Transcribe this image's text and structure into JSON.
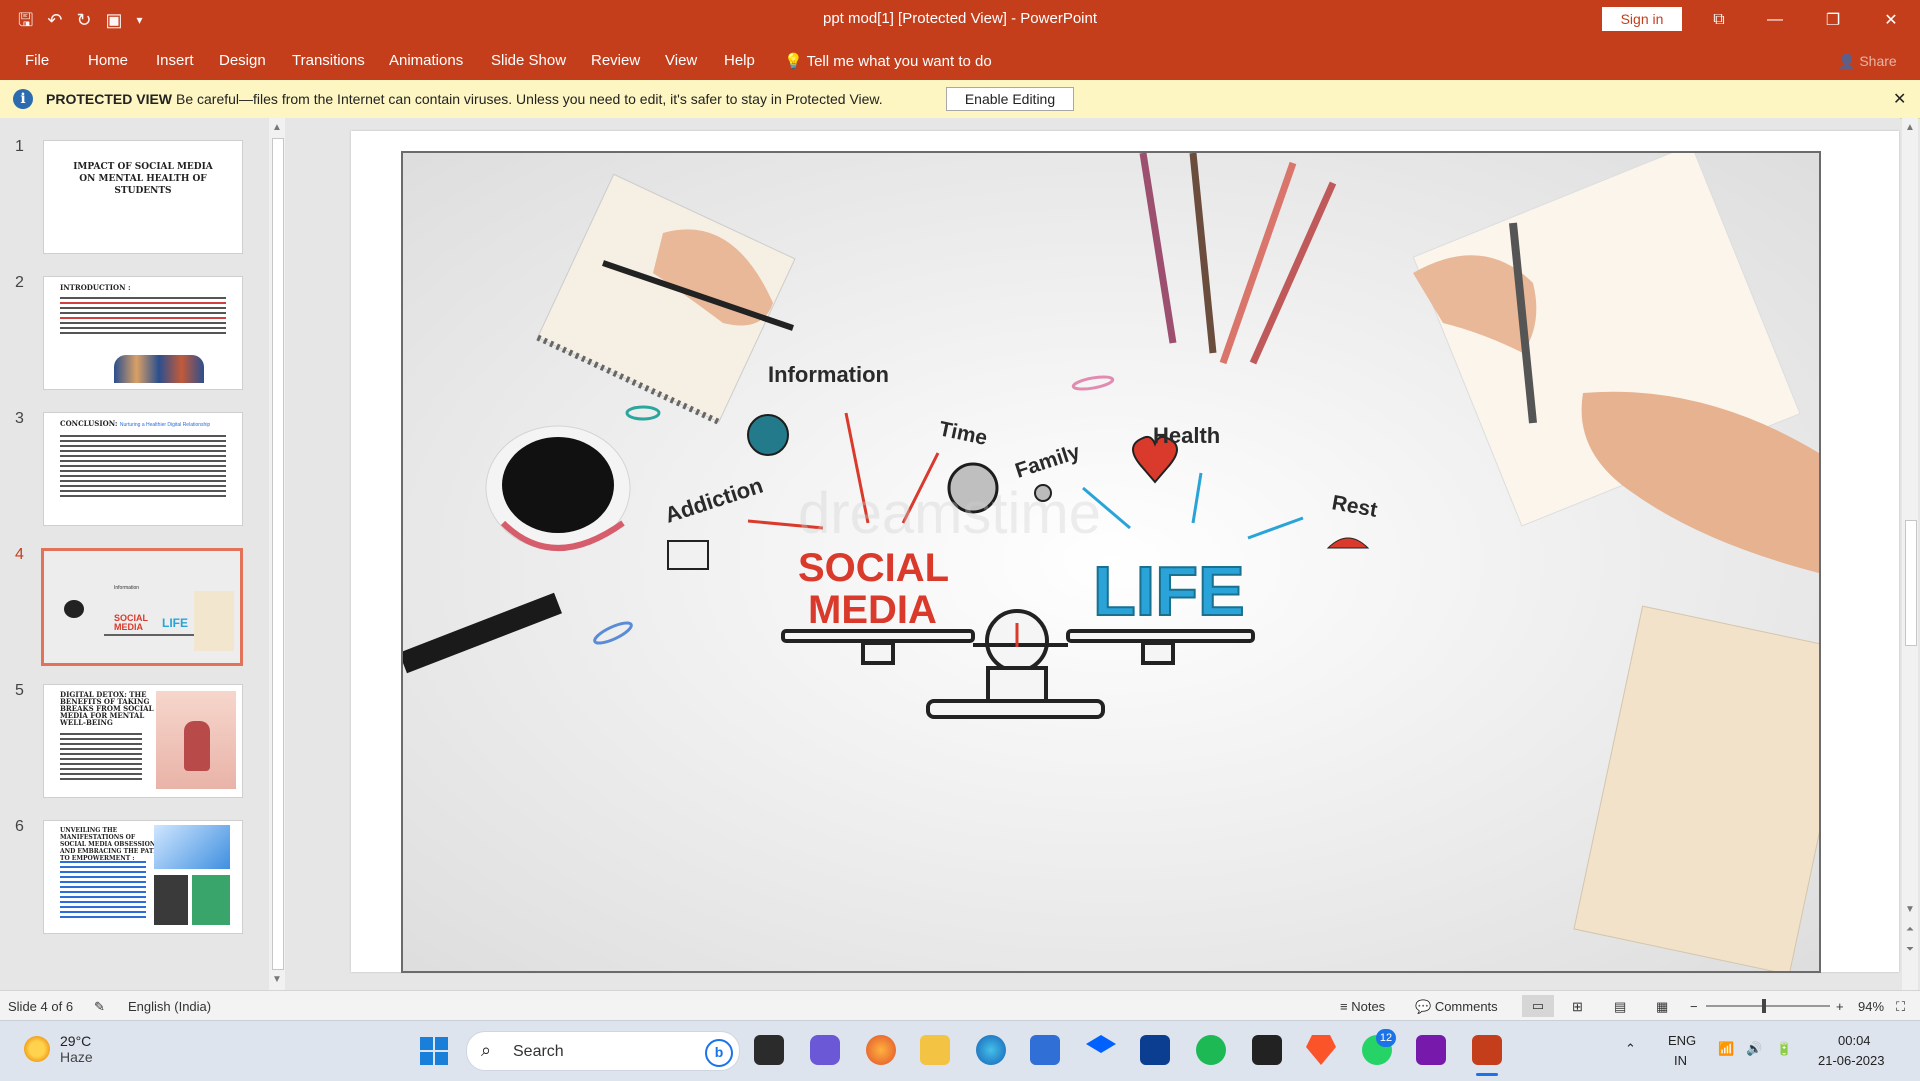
{
  "titlebar": {
    "title": "ppt mod[1] [Protected View]  -  PowerPoint",
    "sign_in": "Sign in",
    "qat_icons": [
      "save-icon",
      "undo-icon",
      "redo-icon",
      "present-icon",
      "customize-icon"
    ]
  },
  "ribbon": {
    "tabs": [
      "File",
      "Home",
      "Insert",
      "Design",
      "Transitions",
      "Animations",
      "Slide Show",
      "Review",
      "View",
      "Help"
    ],
    "tell_me": "Tell me what you want to do",
    "share": "Share"
  },
  "protected_view": {
    "label": "PROTECTED VIEW",
    "message": "Be careful—files from the Internet can contain viruses. Unless you need to edit, it's safer to stay in Protected View.",
    "enable_button": "Enable Editing"
  },
  "thumbnails": {
    "numbers": [
      "1",
      "2",
      "3",
      "4",
      "5",
      "6"
    ],
    "active": 4,
    "slide1_title": "IMPACT OF SOCIAL MEDIA ON MENTAL HEALTH OF STUDENTS",
    "slide2_heading": "INTRODUCTION :",
    "slide3_heading": "CONCLUSION:",
    "slide3_sub": "Nurturing a Healthier Digital Relationship",
    "slide5_heading": "DIGITAL DETOX: THE BENEFITS OF TAKING BREAKS FROM SOCIAL MEDIA FOR MENTAL WELL-BEING",
    "slide6_heading": "UNVEILING THE MANIFESTATIONS OF SOCIAL MEDIA OBSESSION AND EMBRACING THE PATH TO EMPOWERMENT :"
  },
  "slide": {
    "words": {
      "information": "Information",
      "time": "Time",
      "family": "Family",
      "health": "Health",
      "addiction": "Addiction",
      "rest": "Rest",
      "social": "SOCIAL",
      "media": "MEDIA",
      "life": "LIFE",
      "watermark": "dreamstime"
    }
  },
  "statusbar": {
    "slide_info": "Slide 4 of 6",
    "language": "English (India)",
    "notes": "Notes",
    "comments": "Comments",
    "zoom": "94%",
    "zoom_fraction": 0.47
  },
  "taskbar": {
    "temp": "29°C",
    "condition": "Haze",
    "search": "Search",
    "whatsapp_badge": "12",
    "lang1": "ENG",
    "lang2": "IN",
    "time": "00:04",
    "date": "21-06-2023"
  },
  "colors": {
    "accent": "#c43e1c",
    "protected_bg": "#fdf6c3",
    "social_red": "#d93a2b",
    "life_blue": "#2aa4d8"
  }
}
